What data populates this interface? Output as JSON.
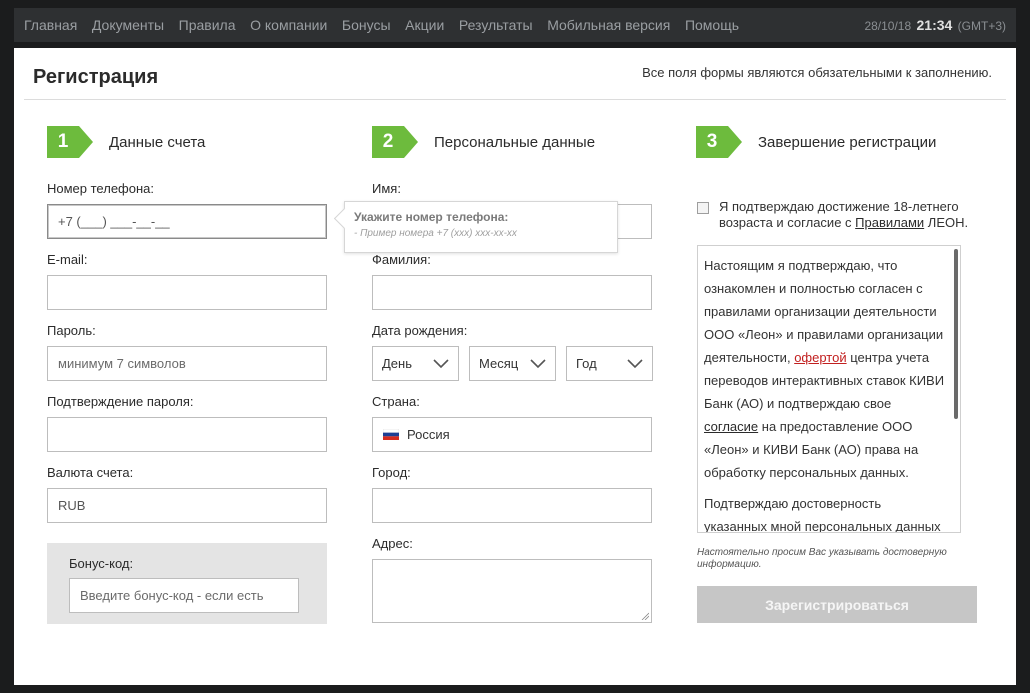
{
  "nav": {
    "items": [
      "Главная",
      "Документы",
      "Правила",
      "О компании",
      "Бонусы",
      "Акции",
      "Результаты",
      "Мобильная версия",
      "Помощь"
    ],
    "date": "28/10/18",
    "time": "21:34",
    "tz": "(GMT+3)"
  },
  "page": {
    "title": "Регистрация",
    "required_note": "Все поля формы являются обязательными к заполнению."
  },
  "steps": [
    {
      "number": "1",
      "title": "Данные счета"
    },
    {
      "number": "2",
      "title": "Персональные данные"
    },
    {
      "number": "3",
      "title": "Завершение регистрации"
    }
  ],
  "account": {
    "phone_label": "Номер телефона:",
    "phone_value": "+7 (___) ___-__-__",
    "email_label": "E-mail:",
    "email_value": "",
    "password_label": "Пароль:",
    "password_placeholder": "минимум 7 символов",
    "confirm_label": "Подтверждение пароля:",
    "confirm_value": "",
    "currency_label": "Валюта счета:",
    "currency_value": "RUB",
    "bonus_label": "Бонус-код:",
    "bonus_placeholder": "Введите бонус-код - если есть"
  },
  "tooltip": {
    "title": "Укажите номер телефона:",
    "hint": "- Пример номера +7 (xxx) xxx-xx-xx"
  },
  "personal": {
    "name_label": "Имя:",
    "surname_label": "Фамилия:",
    "birth_label": "Дата рождения:",
    "day": "День",
    "month": "Месяц",
    "year": "Год",
    "country_label": "Страна:",
    "country_value": "Россия",
    "city_label": "Город:",
    "address_label": "Адрес:"
  },
  "finish": {
    "confirm_pre": "Я подтверждаю достижение 18-летнего возраста и согласие с",
    "confirm_link": "Правилами",
    "confirm_post": "ЛЕОН.",
    "terms_1_a": "Настоящим я подтверждаю, что ознакомлен и полностью согласен с правилами организации деятельности ООО «Леон» и правилами организации деятельности,",
    "terms_1_link": "офертой",
    "terms_1_b": "центра учета переводов интерактивных ставок КИВИ Банк (АО) и подтверждаю свое",
    "terms_1_link2": "согласие",
    "terms_1_c": "на предоставление ООО «Леон» и КИВИ Банк (АО) права на обработку персональных данных.",
    "terms_2": "Подтверждаю достоверность указанных мной персональных данных",
    "note": "Настоятельно просим Вас указывать достоверную информацию.",
    "submit": "Зарегистрироваться"
  },
  "colors": {
    "accent_green": "#6dbb3d",
    "link_red": "#c21f1f",
    "button_disabled": "#c6c6c6"
  }
}
